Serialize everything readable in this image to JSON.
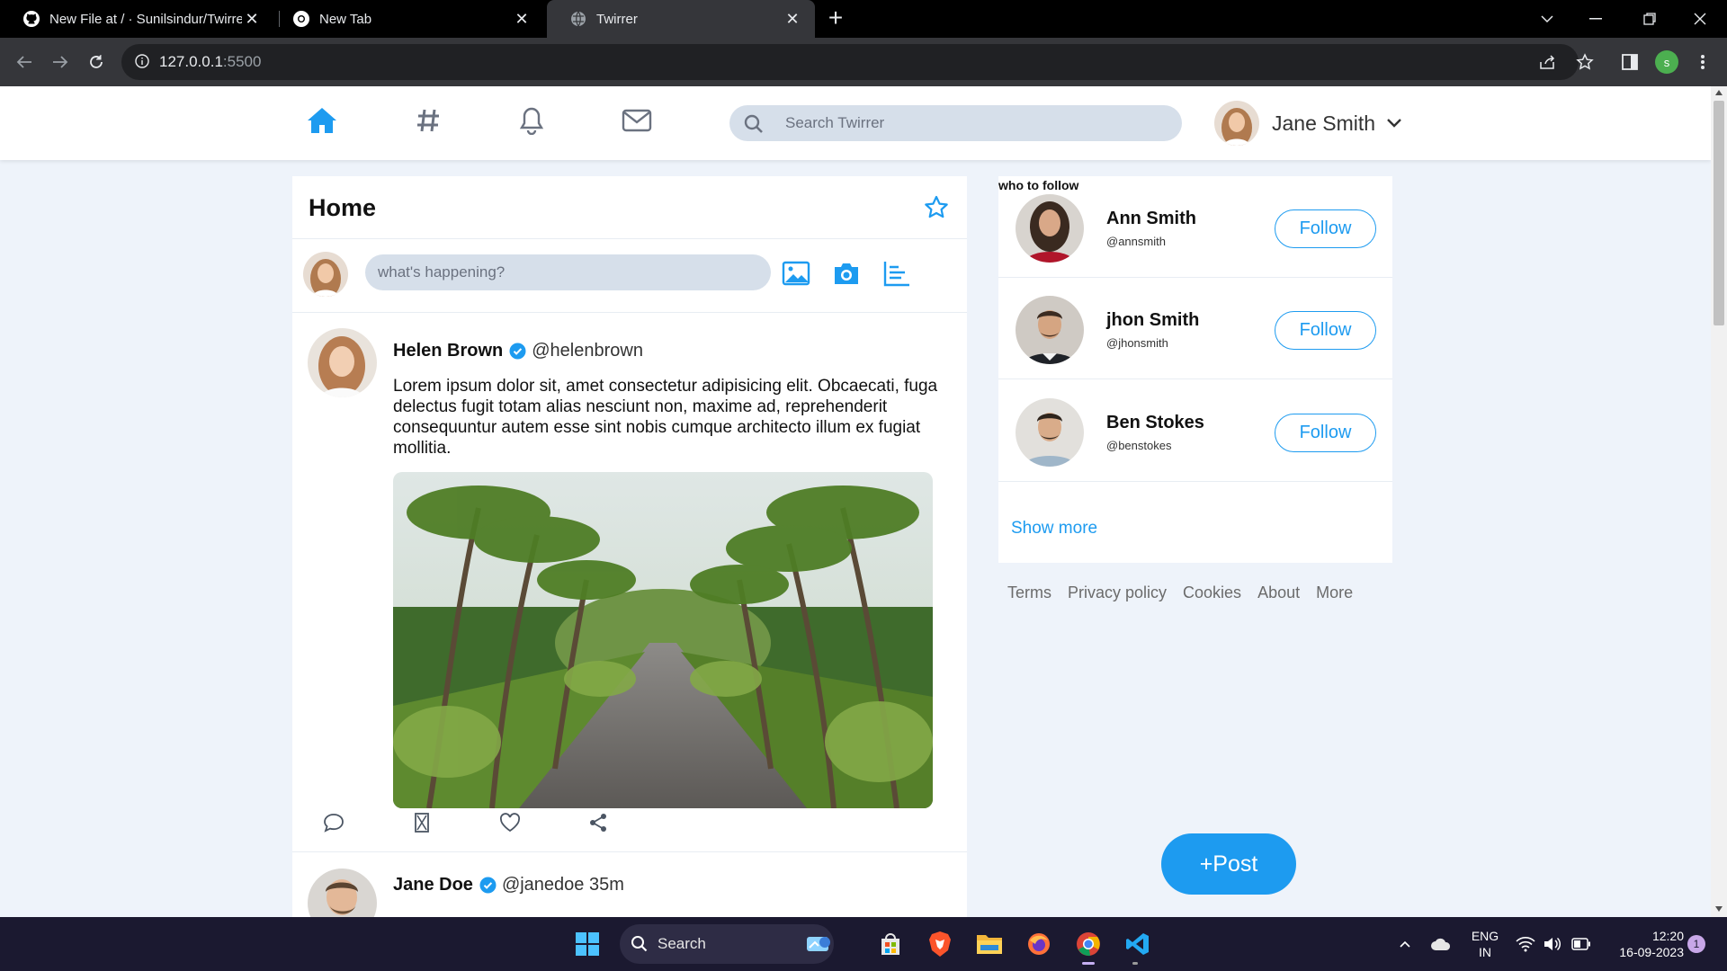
{
  "browser": {
    "tabs": [
      {
        "title": "New File at / · Sunilsindur/Twirrer",
        "icon": "github-icon"
      },
      {
        "title": "New Tab",
        "icon": "chrome-icon"
      },
      {
        "title": "Twirrer",
        "icon": "globe-icon"
      }
    ],
    "url_host": "127.0.0.1",
    "url_port": ":5500",
    "profile_initial": "s"
  },
  "app": {
    "nav_icons": [
      "home-icon",
      "hashtag-icon",
      "bell-icon",
      "mail-icon"
    ],
    "search_placeholder": "Search Twirrer",
    "user_name": "Jane Smith",
    "accent_color": "#1d9bf0"
  },
  "feed": {
    "title": "Home",
    "composer_placeholder": "what's happening?",
    "tweets": [
      {
        "name": "Helen Brown",
        "handle": "@helenbrown",
        "body": "Lorem ipsum dolor sit, amet consectetur adipisicing elit. Obcaecati, fuga delectus fugit totam alias nesciunt non, maxime ad, reprehenderit consequuntur autem esse sint nobis cumque architecto illum ex fugiat mollitia.",
        "has_image": true
      },
      {
        "name": "Jane Doe",
        "handle": "@janedoe 35m"
      }
    ]
  },
  "sidebar": {
    "title": "who to follow",
    "people": [
      {
        "name": "Ann Smith",
        "handle": "@annsmith",
        "button": "Follow"
      },
      {
        "name": "jhon Smith",
        "handle": "@jhonsmith",
        "button": "Follow"
      },
      {
        "name": "Ben Stokes",
        "handle": "@benstokes",
        "button": "Follow"
      }
    ],
    "show_more": "Show more",
    "footer_links": [
      "Terms",
      "Privacy policy",
      "Cookies",
      "About",
      "More"
    ]
  },
  "post_button": "+Post",
  "taskbar": {
    "search_label": "Search",
    "lang_line1": "ENG",
    "lang_line2": "IN",
    "time": "12:20",
    "date": "16-09-2023",
    "notifications": "1"
  }
}
